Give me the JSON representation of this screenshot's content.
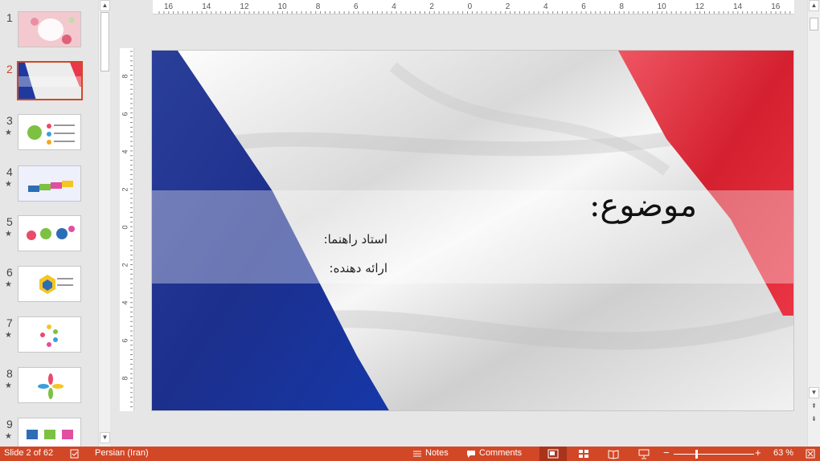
{
  "thumbnails": [
    {
      "num": "1",
      "star": ""
    },
    {
      "num": "2",
      "star": ""
    },
    {
      "num": "3",
      "star": "★"
    },
    {
      "num": "4",
      "star": "★"
    },
    {
      "num": "5",
      "star": "★"
    },
    {
      "num": "6",
      "star": "★"
    },
    {
      "num": "7",
      "star": "★"
    },
    {
      "num": "8",
      "star": "★"
    },
    {
      "num": "9",
      "star": "★"
    }
  ],
  "ruler": {
    "horizontal": [
      "16",
      "14",
      "12",
      "10",
      "8",
      "6",
      "4",
      "2",
      "0",
      "2",
      "4",
      "6",
      "8",
      "10",
      "12",
      "14",
      "16"
    ],
    "vertical": [
      "8",
      "6",
      "4",
      "2",
      "0",
      "2",
      "4",
      "6",
      "8"
    ]
  },
  "slide": {
    "title": "موضوع:",
    "line1": "استاد راهنما:",
    "line2": "ارائه دهنده:",
    "colors": {
      "blue": "#1f3a9e",
      "white": "#f2f2f2",
      "red": "#e8384a"
    }
  },
  "status": {
    "slide_info": "Slide 2 of 62",
    "language": "Persian (Iran)",
    "notes": "Notes",
    "comments": "Comments",
    "zoom": "63 %",
    "accent": "#d24726"
  }
}
